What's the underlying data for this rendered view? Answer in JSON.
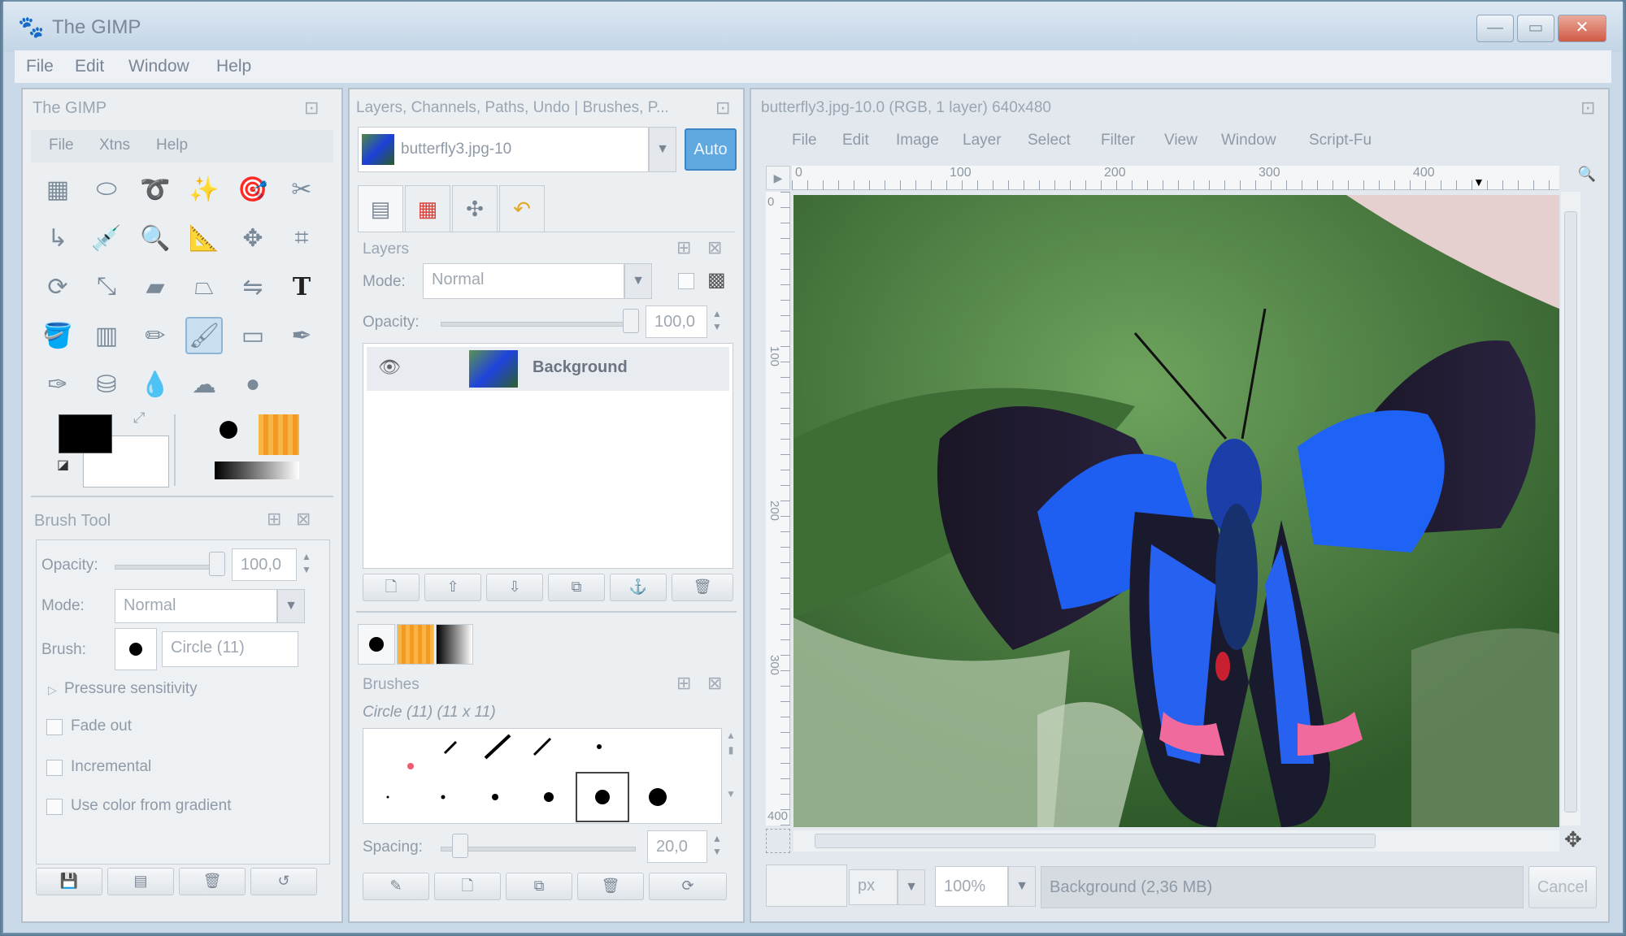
{
  "app": {
    "title": "The GIMP",
    "menu": [
      "File",
      "Edit",
      "Window",
      "Help"
    ],
    "controls": {
      "minimize": "—",
      "maximize": "▭",
      "close": "✕"
    }
  },
  "toolbox": {
    "title": "The GIMP",
    "menu": [
      "File",
      "Xtns",
      "Help"
    ],
    "tools": [
      "rect-select",
      "ellipse-select",
      "free-select",
      "fuzzy-select",
      "select-by-color",
      "scissors",
      "paths",
      "color-picker",
      "zoom",
      "measure",
      "move",
      "crop",
      "rotate",
      "scale",
      "shear",
      "perspective",
      "flip",
      "text",
      "bucket-fill",
      "blend",
      "pencil",
      "paintbrush",
      "eraser",
      "airbrush",
      "ink",
      "clone",
      "heal",
      "smudge",
      "dodge-burn"
    ],
    "selected_tool": "paintbrush",
    "text_glyph": "T"
  },
  "brush_tool": {
    "title": "Brush Tool",
    "opacity_label": "Opacity:",
    "opacity_value": "100,0",
    "mode_label": "Mode:",
    "mode_value": "Normal",
    "brush_label": "Brush:",
    "brush_value": "Circle (11)",
    "options": [
      {
        "label": "Pressure sensitivity",
        "type": "expander"
      },
      {
        "label": "Fade out",
        "type": "checkbox"
      },
      {
        "label": "Incremental",
        "type": "checkbox"
      },
      {
        "label": "Use color from gradient",
        "type": "checkbox"
      }
    ]
  },
  "dock": {
    "title": "Layers, Channels, Paths, Undo | Brushes, P...",
    "image_select": "butterfly3.jpg-10",
    "auto_label": "Auto",
    "layers": {
      "title": "Layers",
      "mode_label": "Mode:",
      "mode_value": "Normal",
      "opacity_label": "Opacity:",
      "opacity_value": "100,0",
      "items": [
        {
          "name": "Background"
        }
      ]
    },
    "brushes": {
      "title": "Brushes",
      "current": "Circle (11) (11 x 11)",
      "spacing_label": "Spacing:",
      "spacing_value": "20,0"
    }
  },
  "image_window": {
    "title": "butterfly3.jpg-10.0 (RGB, 1 layer) 640x480",
    "menu": [
      "File",
      "Edit",
      "Image",
      "Layer",
      "Select",
      "Filter",
      "View",
      "Window",
      "Script-Fu"
    ],
    "ruler_ticks": [
      "0",
      "100",
      "200",
      "300",
      "400"
    ],
    "vruler_ticks": [
      "0",
      "100",
      "200",
      "300",
      "400"
    ],
    "unit": "px",
    "zoom": "100%",
    "status": "Background (2,36 MB)",
    "cancel_label": "Cancel"
  }
}
